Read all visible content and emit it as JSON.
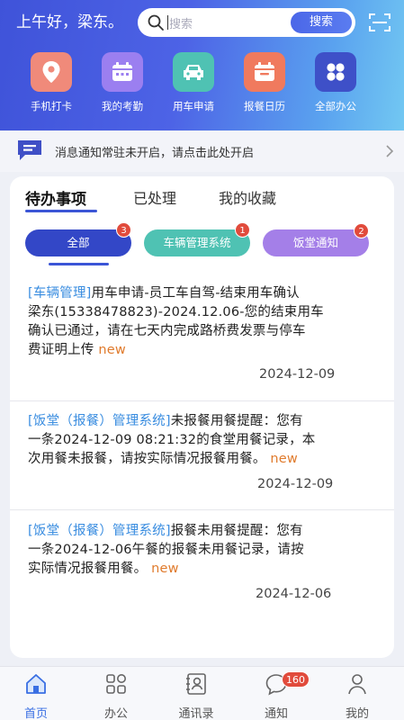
{
  "header": {
    "greeting": "上午好，梁东。",
    "search_placeholder": "搜索",
    "search_button": "搜索"
  },
  "quick_actions": [
    {
      "label": "手机打卡",
      "icon": "location-pin-icon",
      "color": "#f08a7a"
    },
    {
      "label": "我的考勤",
      "icon": "calendar-icon",
      "color": "#9b7ff0"
    },
    {
      "label": "用车申请",
      "icon": "car-icon",
      "color": "#4fc2b3"
    },
    {
      "label": "报餐日历",
      "icon": "calendar-check-icon",
      "color": "#f07a5e"
    },
    {
      "label": "全部办公",
      "icon": "apps-grid-icon",
      "color": "#3e50c8"
    }
  ],
  "notice": {
    "text": "消息通知常驻未开启，请点击此处开启"
  },
  "tabs": [
    {
      "label": "待办事项",
      "active": true
    },
    {
      "label": "已处理",
      "active": false
    },
    {
      "label": "我的收藏",
      "active": false
    }
  ],
  "filters": [
    {
      "label": "全部",
      "badge": "3",
      "color": "#3347c7"
    },
    {
      "label": "车辆管理系统",
      "badge": "1",
      "color": "#4fc2b3"
    },
    {
      "label": "饭堂通知",
      "badge": "2",
      "color": "#a47fe8"
    }
  ],
  "messages": [
    {
      "line1_tag": "[车辆管理]",
      "line1_rest": "用车申请-员工车自驾-结束用车确认",
      "line2": "梁东(15338478823)-2024.12.06-您的结束用车",
      "line3": "确认已通过，请在七天内完成路桥费发票与停车",
      "line4": "费证明上传",
      "new_label": "new",
      "date": "2024-12-09"
    },
    {
      "line1_tag": "[饭堂（报餐）管理系统]",
      "line1_rest": "未报餐用餐提醒：您有",
      "line2": "一条2024-12-09 08:21:32的食堂用餐记录，本",
      "line3": "次用餐未报餐，请按实际情况报餐用餐。",
      "new_label": "new",
      "date": "2024-12-09"
    },
    {
      "line1_tag": "[饭堂（报餐）管理系统]",
      "line1_rest": "报餐未用餐提醒：您有",
      "line2": "一条2024-12-06午餐的报餐未用餐记录，请按",
      "line3": "实际情况报餐用餐。",
      "new_label": "new",
      "date": "2024-12-06"
    }
  ],
  "bottom_nav": [
    {
      "label": "首页",
      "icon": "home-icon",
      "active": true
    },
    {
      "label": "办公",
      "icon": "grid-icon",
      "active": false
    },
    {
      "label": "通讯录",
      "icon": "contacts-icon",
      "active": false
    },
    {
      "label": "通知",
      "icon": "chat-bubble-icon",
      "active": false,
      "badge": "160"
    },
    {
      "label": "我的",
      "icon": "person-icon",
      "active": false
    }
  ],
  "colors": {
    "accent": "#3b55d6",
    "tag_blue": "#3a8de0",
    "new_orange": "#e07b2d",
    "badge_red": "#e14b3c"
  }
}
